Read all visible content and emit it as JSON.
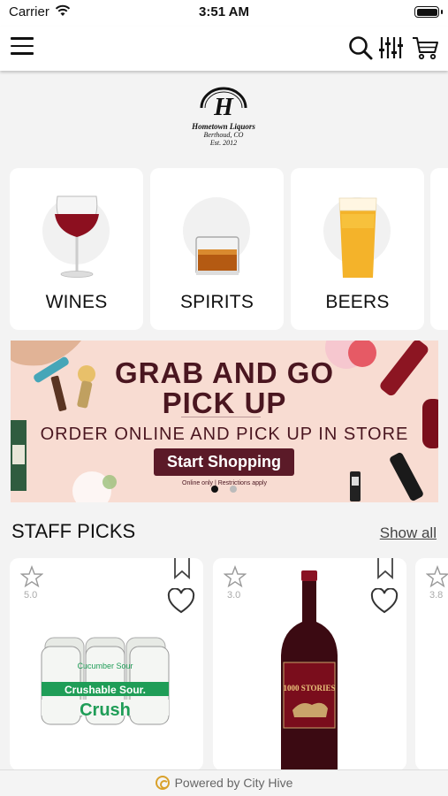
{
  "status_bar": {
    "carrier": "Carrier",
    "time": "3:51 AM"
  },
  "header": {
    "menu_icon": "hamburger-menu-icon",
    "search_icon": "search-icon",
    "filter_icon": "filter-sliders-icon",
    "cart_icon": "cart-icon"
  },
  "logo": {
    "monogram": "H",
    "name": "Hometown Liquors",
    "location": "Berthoud, CO",
    "established": "Est. 2012"
  },
  "categories": [
    {
      "label": "WINES",
      "icon": "wine-glass-icon"
    },
    {
      "label": "SPIRITS",
      "icon": "whiskey-glass-icon"
    },
    {
      "label": "BEERS",
      "icon": "beer-glass-icon"
    }
  ],
  "banner": {
    "title_line1": "GRAB AND GO",
    "title_line2": "PICK UP",
    "subtitle": "ORDER ONLINE AND PICK UP IN STORE",
    "cta": "Start Shopping",
    "note": "Online only | Restrictions apply",
    "active_slide": 1,
    "total_slides": 2
  },
  "staff_picks": {
    "title": "STAFF PICKS",
    "show_all": "Show all",
    "products": [
      {
        "rating": "5.0",
        "image_text_top": "Cucumber Sour",
        "image_text_band": "Crushable Sour.",
        "image_text_big": "Crush"
      },
      {
        "rating": "3.0",
        "image_text_label": "1000 STORIES"
      },
      {
        "rating": "3.8"
      }
    ]
  },
  "colors": {
    "banner_bg": "#f8dcd2",
    "banner_text": "#4a1620",
    "banner_button": "#5b1a28",
    "footer_accent": "#d9a12b"
  },
  "footer": {
    "text": "Powered by City Hive"
  }
}
